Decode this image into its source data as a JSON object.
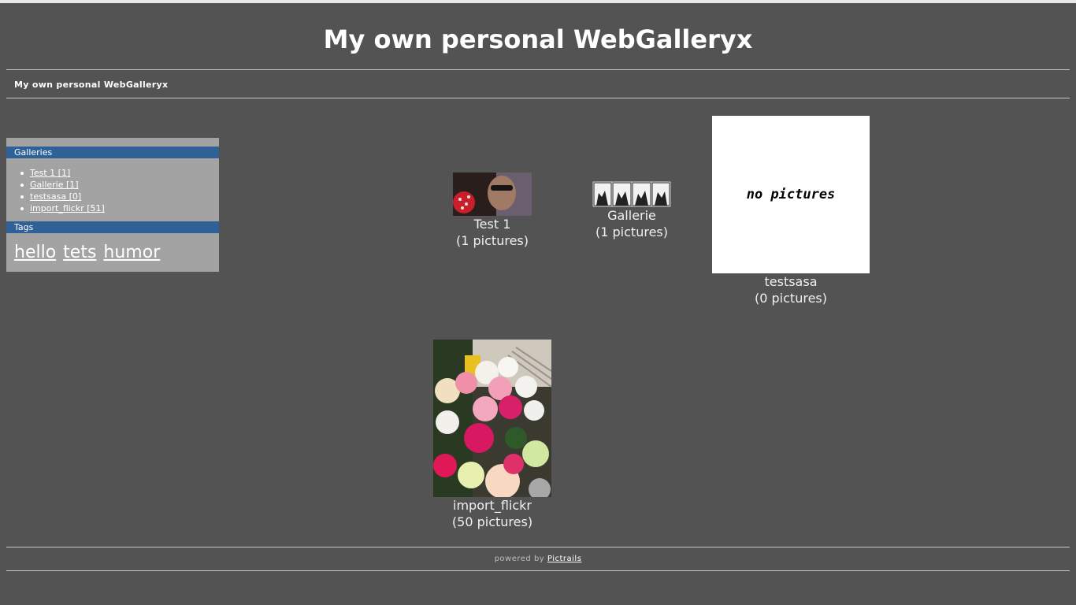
{
  "header": {
    "title": "My own personal WebGalleryx"
  },
  "breadcrumb": {
    "text": "My own personal WebGalleryx"
  },
  "sidebar": {
    "galleries_heading": "Galleries",
    "galleries": [
      {
        "label": "Test 1 [1]"
      },
      {
        "label": "Gallerie [1]"
      },
      {
        "label": "testsasa [0]"
      },
      {
        "label": "import_flickr [51]"
      }
    ],
    "tags_heading": "Tags",
    "tags": [
      {
        "label": "hello"
      },
      {
        "label": "tets"
      },
      {
        "label": "humor"
      }
    ]
  },
  "galleries": [
    {
      "name": "Test 1",
      "count": "(1 pictures)"
    },
    {
      "name": "Gallerie",
      "count": "(1 pictures)"
    },
    {
      "name": "testsasa",
      "count": "(0 pictures)",
      "placeholder": "no pictures"
    },
    {
      "name": "import_flickr",
      "count": "(50 pictures)"
    }
  ],
  "footer": {
    "prefix": "powered by",
    "link": "Pictrails"
  },
  "colors": {
    "background": "#535353",
    "sidebar": "#a3a3a3",
    "sidebar_heading": "#2f6196"
  }
}
